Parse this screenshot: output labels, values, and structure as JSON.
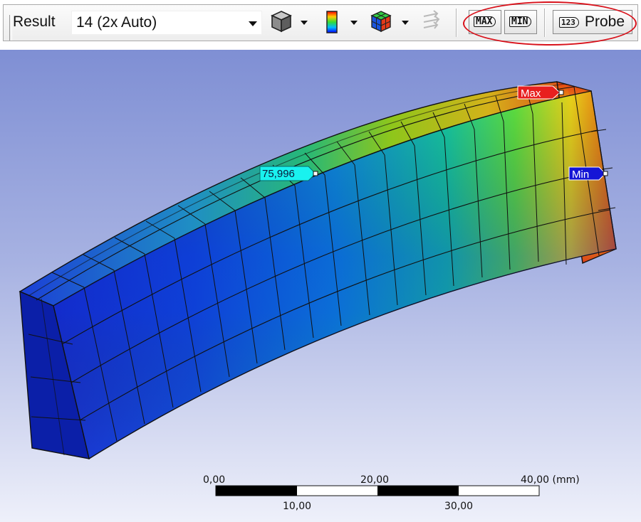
{
  "toolbar": {
    "result_label": "Result",
    "scale_combo_value": "14 (2x Auto)",
    "icons": [
      "geometry-cube-icon",
      "contour-legend-icon",
      "edges-mesh-icon",
      "vector-arrows-icon"
    ],
    "max_button": "MAX",
    "min_button": "MIN",
    "probe_icon": "123",
    "probe_label": "Probe"
  },
  "viewport": {
    "max_label": "Max",
    "min_label": "Min",
    "probe_value": "75,996",
    "colors": {
      "max_tag": "#e81f1f",
      "min_tag": "#1515d6",
      "probe_tag": "#19f2ef"
    }
  },
  "scale_bar": {
    "top_labels": [
      "0,00",
      "20,00",
      "40,00 (mm)"
    ],
    "bottom_labels": [
      "10,00",
      "30,00"
    ]
  }
}
